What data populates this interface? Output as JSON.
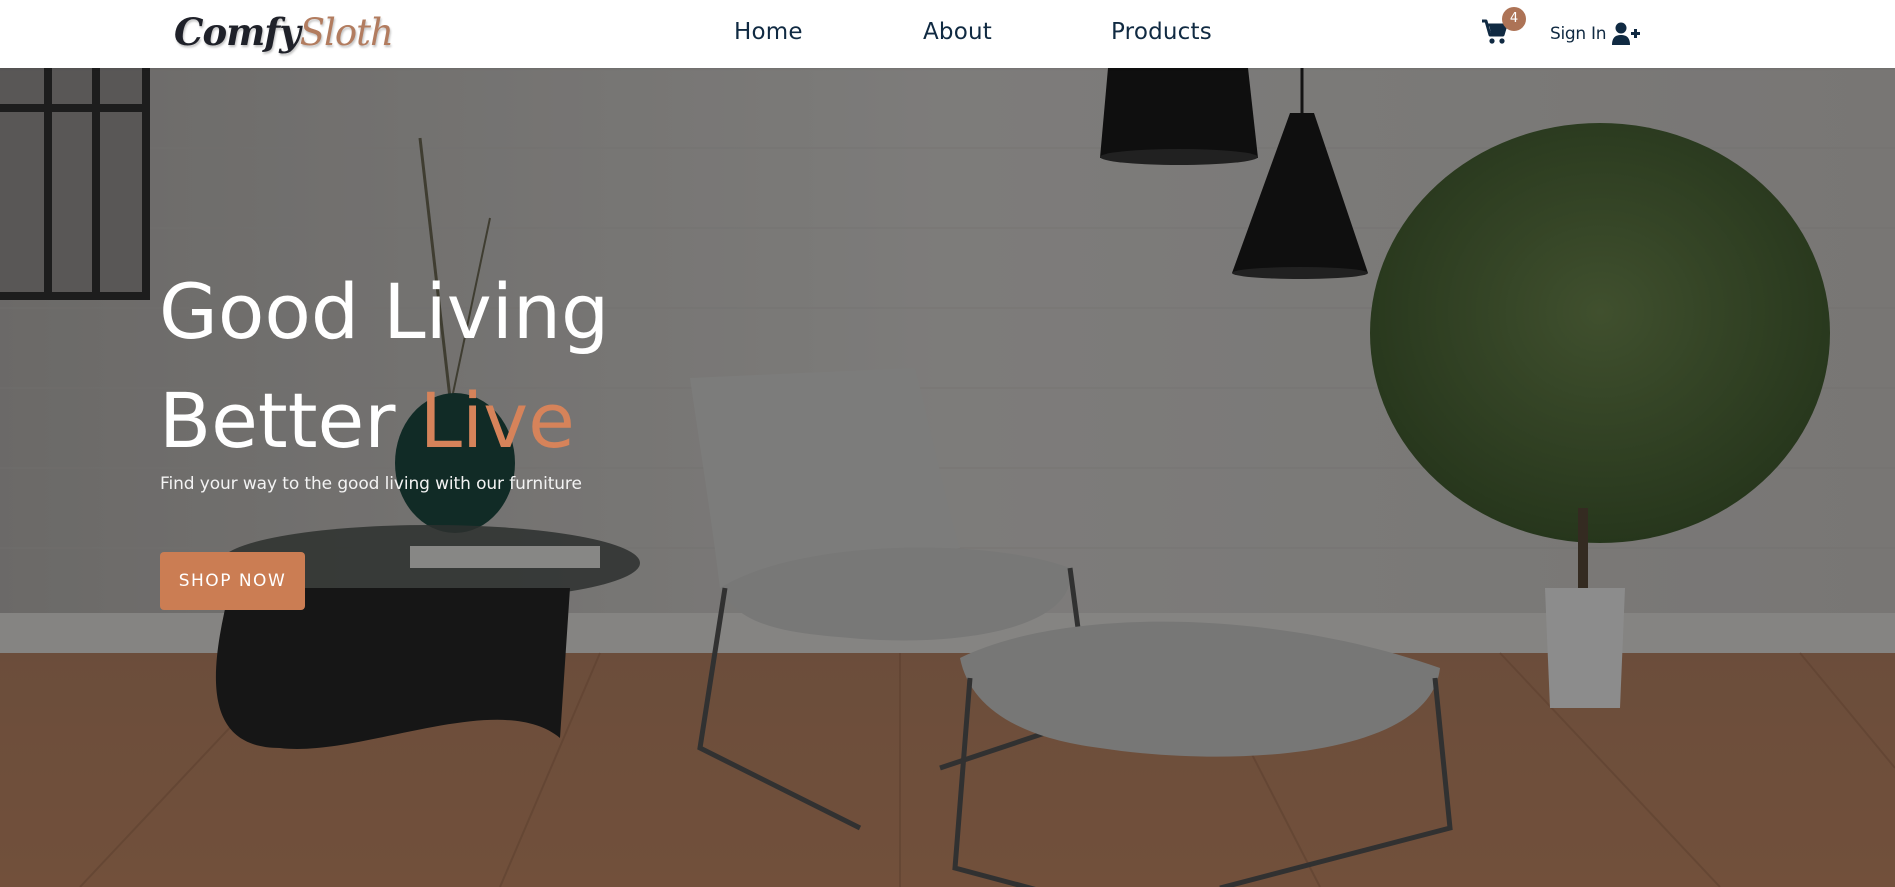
{
  "navbar": {
    "logo": {
      "part1": "Comfy",
      "part2": "Sloth"
    },
    "links": [
      {
        "label": "Home"
      },
      {
        "label": "About"
      },
      {
        "label": "Products"
      }
    ],
    "cart": {
      "icon": "shopping-cart-icon",
      "count": "4"
    },
    "signin": {
      "label": "Sign In",
      "icon": "user-plus-icon"
    }
  },
  "hero": {
    "title_line1": "Good Living",
    "title_line2_prefix": "Better",
    "title_line2_accent": "Live",
    "subtitle": "Find your way to the good living with our furniture",
    "cta_label": "SHOP NOW"
  },
  "colors": {
    "brand_dark": "#102a42",
    "accent": "#cb7d53",
    "badge": "#ad7356",
    "logo_secondary": "#b27c5f"
  }
}
